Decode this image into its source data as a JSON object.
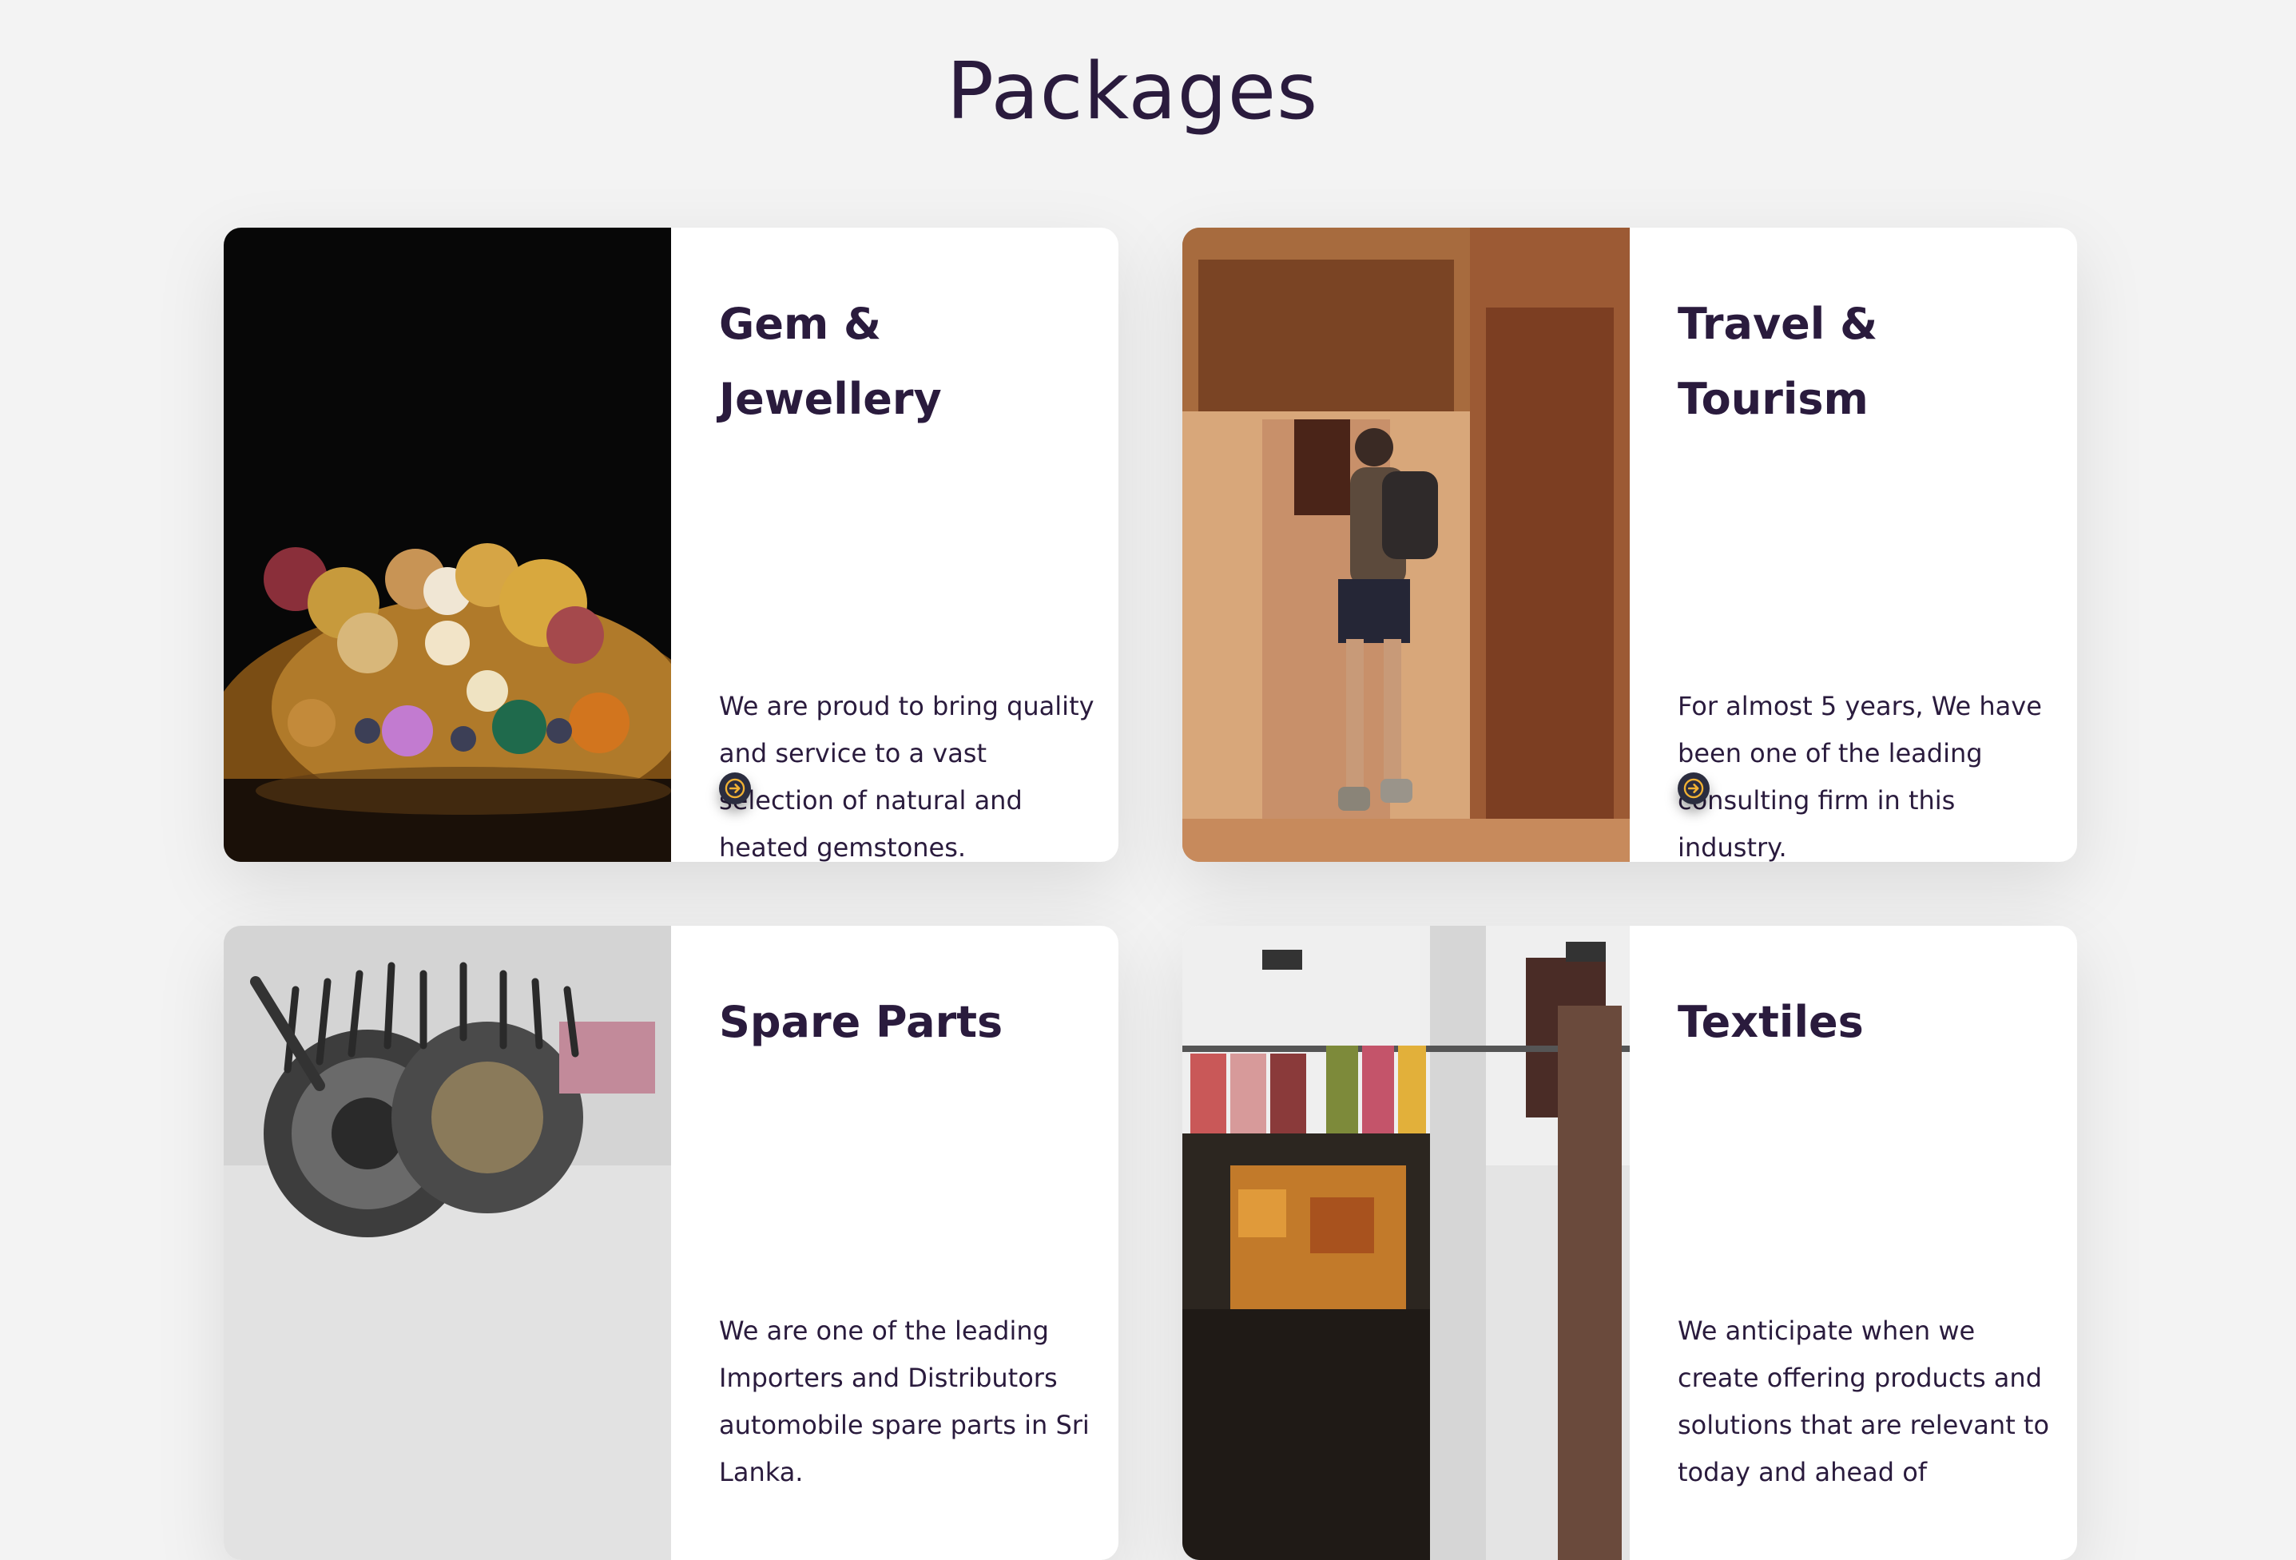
{
  "section": {
    "title": "Packages"
  },
  "packages": [
    {
      "title_line1": "Gem &",
      "title_line2": "Jewellery",
      "description": "We are proud to bring quality and service to a vast selection of natural and heated gemstones.",
      "image_alt": "gold jewellery with gemstones"
    },
    {
      "title_line1": "Travel &",
      "title_line2": "Tourism",
      "description": "For almost 5 years,  We have been one of the leading consulting firm in this industry.",
      "image_alt": "traveller walking through ancient brick archway"
    },
    {
      "title_line1": "Spare Parts",
      "title_line2": "",
      "description": "We are one of the leading Importers and Distributors automobile spare parts in Sri Lanka.",
      "image_alt": "automobile spare parts"
    },
    {
      "title_line1": "Textiles",
      "title_line2": "",
      "description": "We anticipate when we create offering products and solutions that are relevant to today and ahead of",
      "image_alt": "clothing store interior"
    }
  ],
  "colors": {
    "background": "#f3f3f3",
    "card": "#ffffff",
    "heading": "#2a1b3d",
    "arrow_bg": "#2b2d3f",
    "arrow_fg": "#f2b233"
  },
  "icons": {
    "arrow": "arrow-right-circle-icon"
  }
}
